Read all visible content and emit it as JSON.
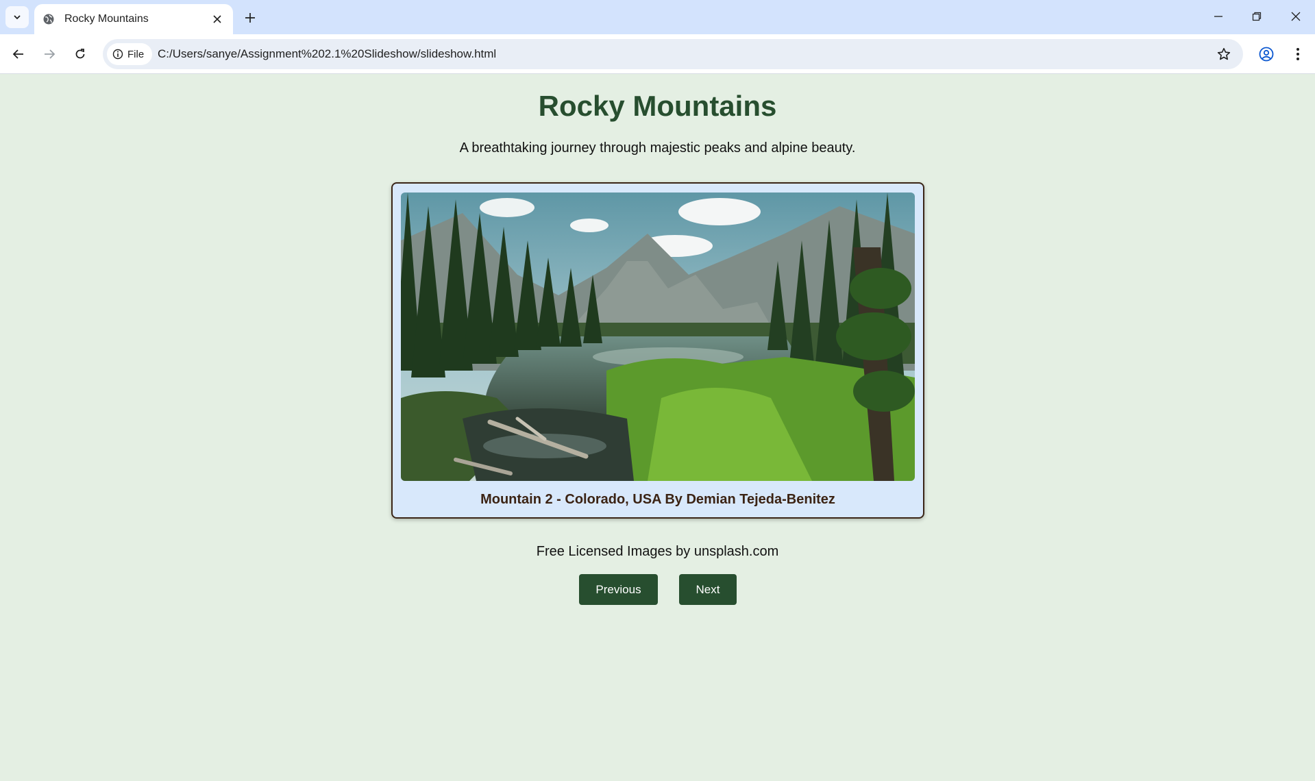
{
  "browser": {
    "tab_title": "Rocky Mountains",
    "chip_label": "File",
    "url": "C:/Users/sanye/Assignment%202.1%20Slideshow/slideshow.html",
    "icons": [
      "tab-search-icon",
      "globe-icon",
      "close-icon",
      "plus-icon",
      "minimize-icon",
      "restore-icon",
      "window-close-icon",
      "back-arrow-icon",
      "forward-arrow-icon",
      "reload-icon",
      "info-icon",
      "star-icon",
      "profile-icon",
      "kebab-menu-icon"
    ]
  },
  "page": {
    "title": "Rocky Mountains",
    "subtitle": "A breathtaking journey through majestic peaks and alpine beauty.",
    "slide": {
      "caption": "Mountain 2 - Colorado, USA By Demian Tejeda-Benitez"
    },
    "credit": "Free Licensed Images by unsplash.com",
    "buttons": {
      "previous": "Previous",
      "next": "Next"
    }
  },
  "colors": {
    "page_background": "#e4efe3",
    "title_green": "#274e2f",
    "button_green": "#274e2f",
    "frame_background": "#d8e8fb",
    "frame_border": "#3a2516",
    "tabstrip": "#d3e3fd"
  }
}
